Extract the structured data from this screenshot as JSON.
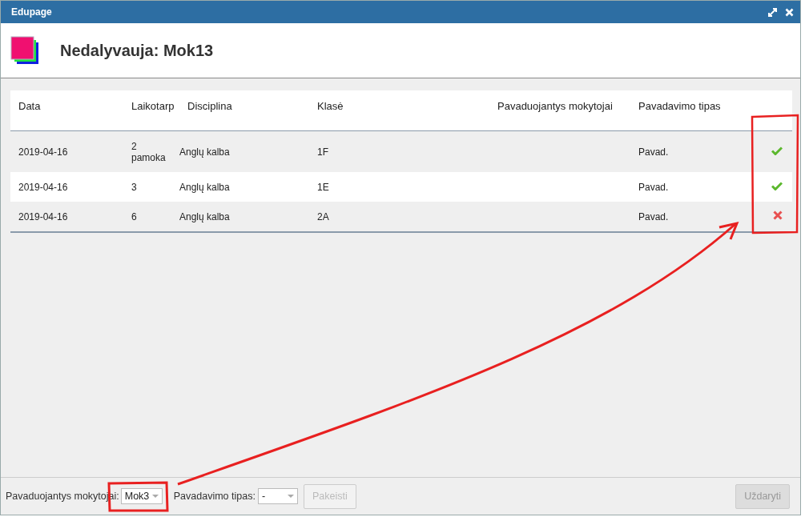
{
  "window": {
    "title": "Edupage"
  },
  "header": {
    "title": "Nedalyvauja: Mok13"
  },
  "table": {
    "columns": [
      "Data",
      "Laikotarp",
      "Disciplina",
      "Klasė",
      "Pavaduojantys mokytojai",
      "Pavadavimo tipas"
    ],
    "rows": [
      {
        "cells": [
          "2019-04-16",
          "2 pamoka",
          "Anglų kalba",
          "1F",
          "",
          "Pavad."
        ],
        "approved": true
      },
      {
        "cells": [
          "2019-04-16",
          "3",
          "Anglų kalba",
          "1E",
          "",
          "Pavad."
        ],
        "approved": true
      },
      {
        "cells": [
          "2019-04-16",
          "6",
          "Anglų kalba",
          "2A",
          "",
          "Pavad."
        ],
        "approved": false
      }
    ]
  },
  "footer": {
    "teacher_label": "Pavaduojantys mokytojai:",
    "teacher_value": "Mok3",
    "type_label": "Pavadavimo tipas:",
    "type_value": "-",
    "change_button": {
      "label": "Pakeisti",
      "disabled": true
    },
    "close_button": {
      "label": "Uždaryti",
      "disabled": true
    }
  }
}
